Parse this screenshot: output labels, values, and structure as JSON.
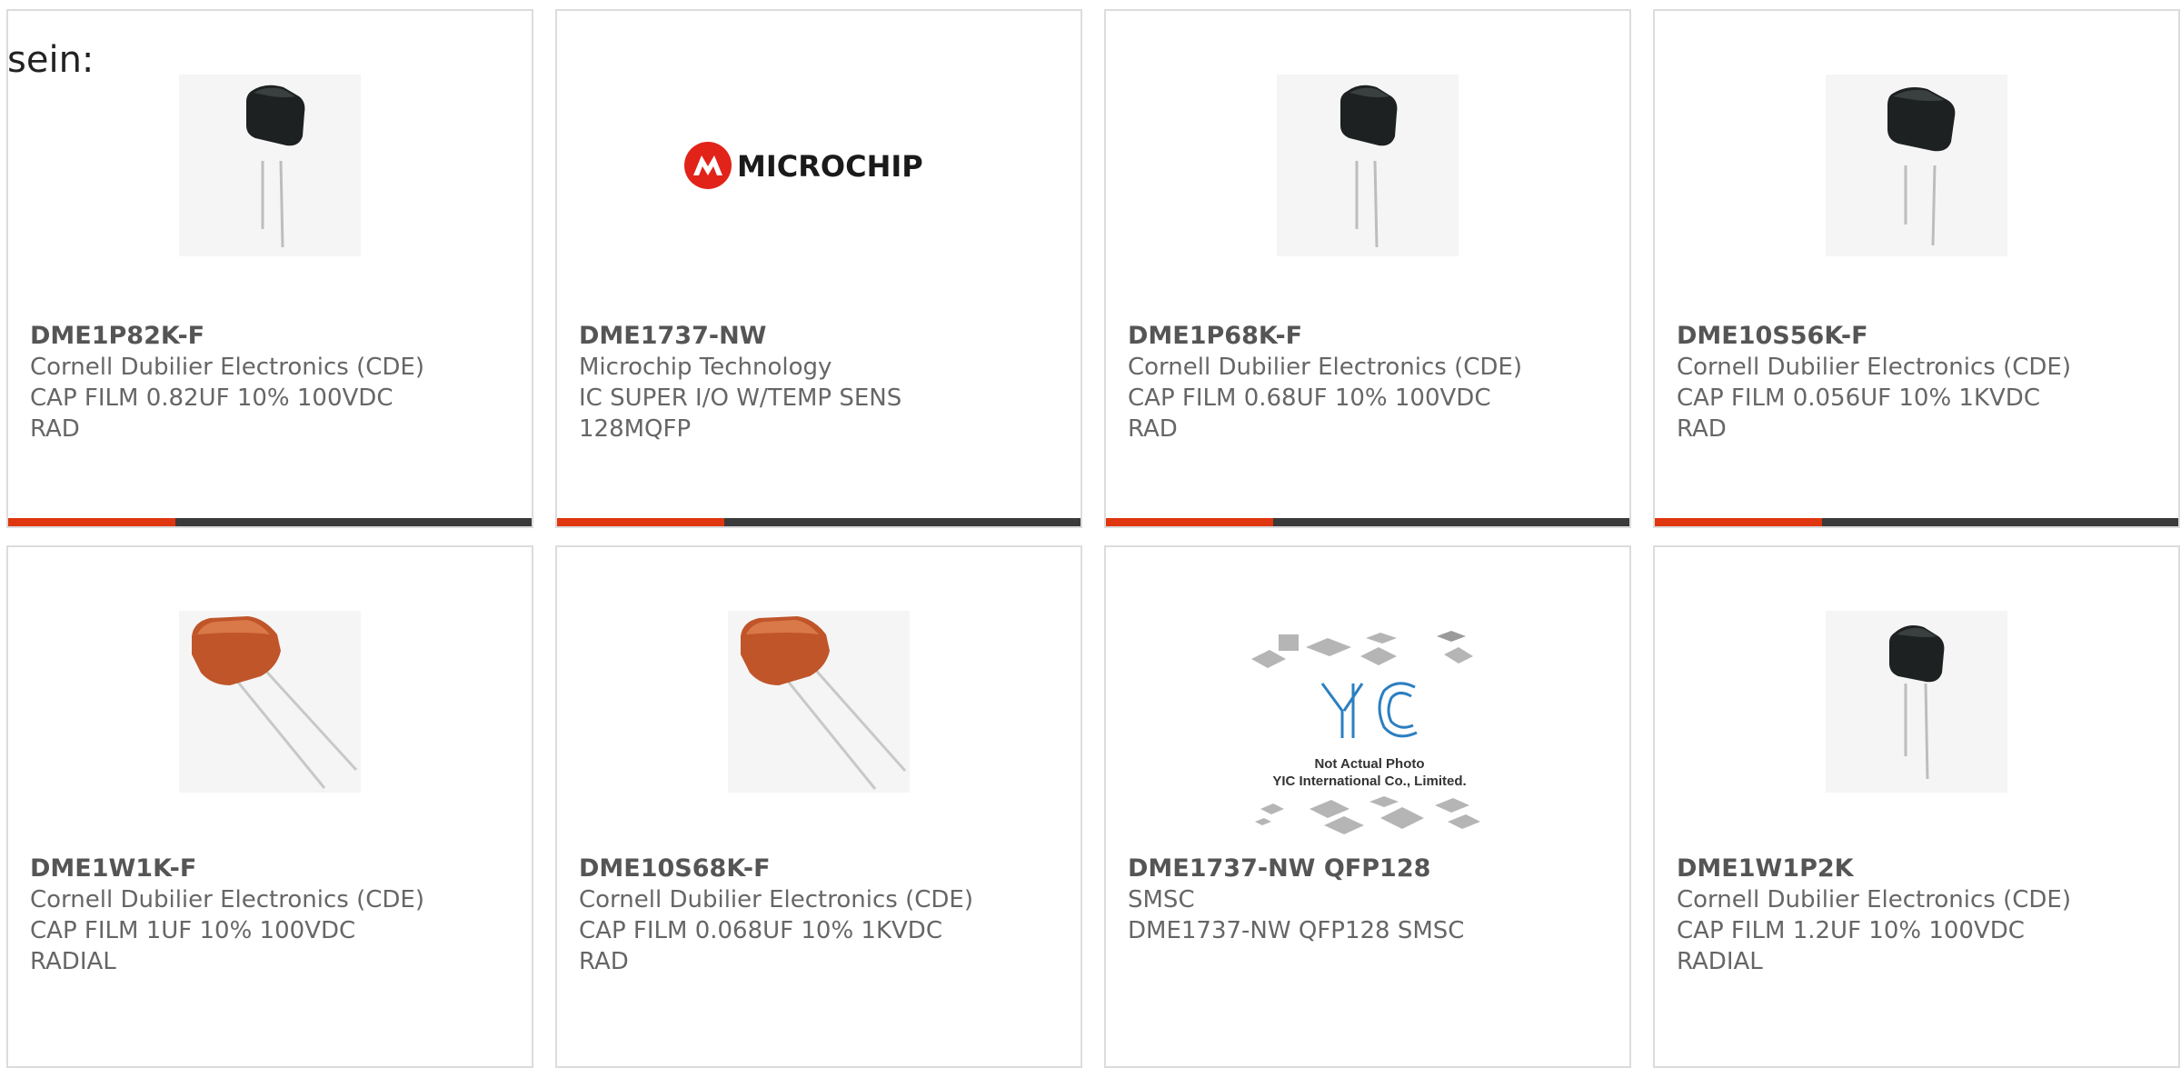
{
  "intro_text": "sein:",
  "accent_color": "#e0360f",
  "bar_color": "#3a3a3a",
  "products": [
    {
      "part_number": "DME1P82K-F",
      "manufacturer": "Cornell Dubilier Electronics (CDE)",
      "description": "CAP FILM 0.82UF 10% 100VDC RAD",
      "image": "black-film-capacitor"
    },
    {
      "part_number": "DME1737-NW",
      "manufacturer": "Microchip Technology",
      "description": "IC SUPER I/O W/TEMP SENS 128MQFP",
      "image": "microchip-logo",
      "logo_text": "MICROCHIP"
    },
    {
      "part_number": "DME1P68K-F",
      "manufacturer": "Cornell Dubilier Electronics (CDE)",
      "description": "CAP FILM 0.68UF 10% 100VDC RAD",
      "image": "black-film-capacitor"
    },
    {
      "part_number": "DME10S56K-F",
      "manufacturer": "Cornell Dubilier Electronics (CDE)",
      "description": "CAP FILM 0.056UF 10% 1KVDC RAD",
      "image": "black-film-capacitor"
    },
    {
      "part_number": "DME1W1K-F",
      "manufacturer": "Cornell Dubilier Electronics (CDE)",
      "description": "CAP FILM 1UF 10% 100VDC RADIAL",
      "image": "orange-film-capacitor"
    },
    {
      "part_number": "DME10S68K-F",
      "manufacturer": "Cornell Dubilier Electronics (CDE)",
      "description": "CAP FILM 0.068UF 10% 1KVDC RAD",
      "image": "orange-film-capacitor"
    },
    {
      "part_number": "DME1737-NW QFP128",
      "manufacturer": "SMSC",
      "description": "DME1737-NW QFP128 SMSC",
      "image": "yic-placeholder",
      "logo_text": "YIC",
      "photo_note": "Not Actual Photo",
      "photo_company": "YIC International Co., Limited."
    },
    {
      "part_number": "DME1W1P2K",
      "manufacturer": "Cornell Dubilier Electronics (CDE)",
      "description": "CAP FILM 1.2UF 10% 100VDC RADIAL",
      "image": "black-film-capacitor"
    }
  ],
  "progress_bars": [
    0.32,
    0.32,
    0.32,
    0.32
  ]
}
